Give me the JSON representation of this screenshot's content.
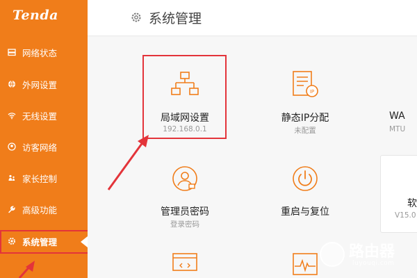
{
  "brand": {
    "logo": "Tenda",
    "accent": "#f07d1a",
    "highlight": "#e3343a"
  },
  "sidebar": {
    "items": [
      {
        "label": "网络状态",
        "icon": "network-status-icon",
        "active": false
      },
      {
        "label": "外网设置",
        "icon": "globe-icon",
        "active": false
      },
      {
        "label": "无线设置",
        "icon": "wifi-icon",
        "active": false
      },
      {
        "label": "访客网络",
        "icon": "guest-icon",
        "active": false
      },
      {
        "label": "家长控制",
        "icon": "parental-control-icon",
        "active": false
      },
      {
        "label": "高级功能",
        "icon": "wrench-icon",
        "active": false
      },
      {
        "label": "系统管理",
        "icon": "gear-icon",
        "active": true
      }
    ]
  },
  "header": {
    "title": "系统管理",
    "icon": "gear-icon"
  },
  "tiles": [
    {
      "title": "局域网设置",
      "subtitle": "192.168.0.1",
      "icon": "lan-topology-icon"
    },
    {
      "title": "静态IP分配",
      "subtitle": "未配置",
      "icon": "static-ip-icon"
    },
    {
      "title": "WA",
      "subtitle": "MTU",
      "icon": "wan-icon"
    },
    {
      "title": "管理员密码",
      "subtitle": "登录密码",
      "icon": "admin-user-icon"
    },
    {
      "title": "重启与复位",
      "subtitle": "",
      "icon": "power-icon"
    },
    {
      "title": "软",
      "subtitle": "V15.0",
      "icon": "firmware-icon"
    },
    {
      "title": "",
      "subtitle": "",
      "icon": "monitor-icon"
    },
    {
      "title": "",
      "subtitle": "",
      "icon": "waveform-icon"
    }
  ],
  "watermark": {
    "text": "路由器",
    "sub": "luyouqi.com"
  }
}
